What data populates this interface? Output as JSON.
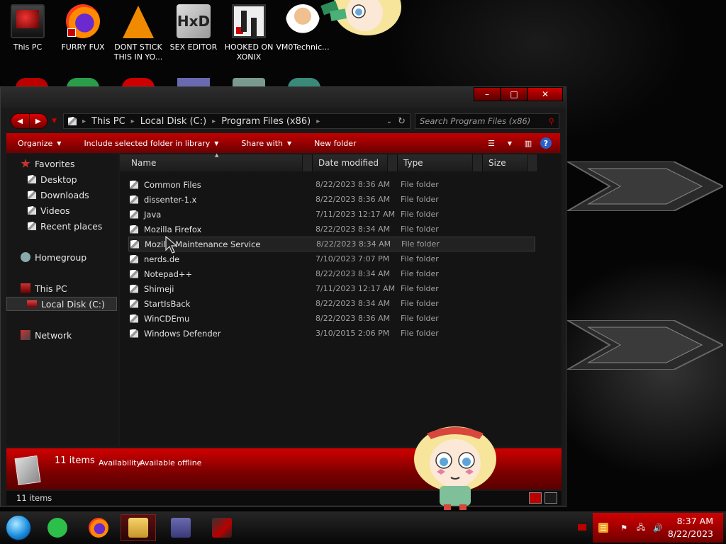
{
  "desktop": {
    "icons": [
      {
        "label": "This PC"
      },
      {
        "label": "FURRY FUX"
      },
      {
        "label": "DONT STICK THIS IN YO..."
      },
      {
        "label": "SEX EDITOR"
      },
      {
        "label": "HOOKED ON XONIX"
      },
      {
        "label": "VM0Technic..."
      }
    ]
  },
  "window": {
    "controls": {
      "minimize": "–",
      "maximize": "□",
      "close": "✕"
    },
    "breadcrumbs": [
      "This PC",
      "Local Disk (C:)",
      "Program Files (x86)"
    ],
    "search_placeholder": "Search Program Files (x86)",
    "toolbar": {
      "organize": "Organize",
      "include": "Include selected folder in library",
      "share": "Share with",
      "new_folder": "New folder"
    },
    "nav": {
      "favorites": "Favorites",
      "desktop": "Desktop",
      "downloads": "Downloads",
      "videos": "Videos",
      "recent": "Recent places",
      "homegroup": "Homegroup",
      "this_pc": "This PC",
      "local_disk": "Local Disk (C:)",
      "network": "Network"
    },
    "columns": {
      "name": "Name",
      "date": "Date modified",
      "type": "Type",
      "size": "Size"
    },
    "files": [
      {
        "name": "Common Files",
        "date": "8/22/2023 8:36 AM",
        "type": "File folder"
      },
      {
        "name": "dissenter-1.x",
        "date": "8/22/2023 8:36 AM",
        "type": "File folder"
      },
      {
        "name": "Java",
        "date": "7/11/2023 12:17 AM",
        "type": "File folder"
      },
      {
        "name": "Mozilla Firefox",
        "date": "8/22/2023 8:34 AM",
        "type": "File folder"
      },
      {
        "name": "Mozilla Maintenance Service",
        "date": "8/22/2023 8:34 AM",
        "type": "File folder"
      },
      {
        "name": "nerds.de",
        "date": "7/10/2023 7:07 PM",
        "type": "File folder"
      },
      {
        "name": "Notepad++",
        "date": "8/22/2023 8:34 AM",
        "type": "File folder"
      },
      {
        "name": "Shimeji",
        "date": "7/11/2023 12:17 AM",
        "type": "File folder"
      },
      {
        "name": "StartIsBack",
        "date": "8/22/2023 8:34 AM",
        "type": "File folder"
      },
      {
        "name": "WinCDEmu",
        "date": "8/22/2023 8:36 AM",
        "type": "File folder"
      },
      {
        "name": "Windows Defender",
        "date": "3/10/2015 2:06 PM",
        "type": "File folder"
      }
    ],
    "details": {
      "count": "11 items",
      "availability_label": "Availability:",
      "availability_value": "Available offline"
    },
    "status": {
      "count": "11 items"
    }
  },
  "taskbar": {
    "clock_time": "8:37 AM",
    "clock_date": "8/22/2023"
  },
  "colors": {
    "accent": "#c00000",
    "window_bg": "#1a1a1a",
    "text": "#d8d8d8"
  }
}
